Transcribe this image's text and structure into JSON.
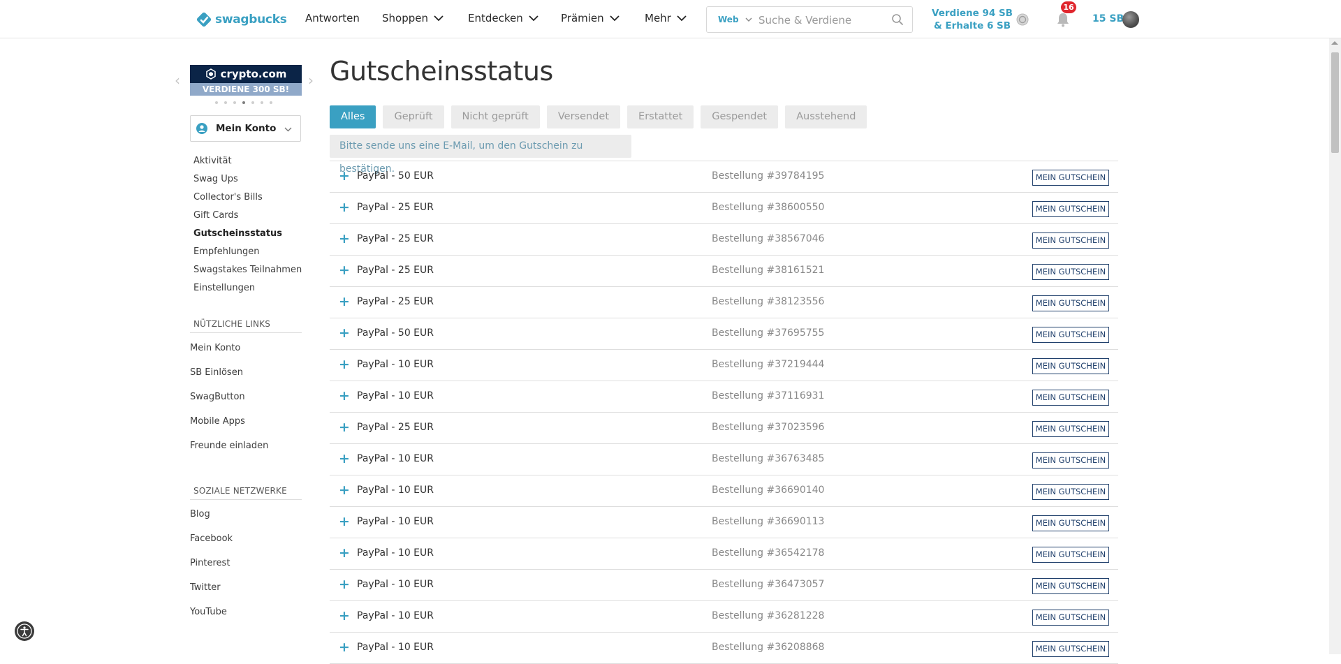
{
  "header": {
    "logo_text": "swagbucks",
    "nav": [
      {
        "label": "Antworten"
      },
      {
        "label": "Shoppen"
      },
      {
        "label": "Entdecken"
      },
      {
        "label": "Prämien"
      },
      {
        "label": "Mehr"
      }
    ],
    "search": {
      "scope": "Web",
      "placeholder": "Suche & Verdiene"
    },
    "earn_line1": "Verdiene 94 SB",
    "earn_line2": "& Erhalte 6 SB",
    "notification_count": "16",
    "sb_balance": "15 SB"
  },
  "sidebar": {
    "promo_brand": "crypto.com",
    "promo_cta": "VERDIENE 300 SB!",
    "account_label": "Mein Konto",
    "links": [
      {
        "label": "Aktivität"
      },
      {
        "label": "Swag Ups"
      },
      {
        "label": "Collector's Bills"
      },
      {
        "label": "Gift Cards"
      },
      {
        "label": "Gutscheinsstatus"
      },
      {
        "label": "Empfehlungen"
      },
      {
        "label": "Swagstakes Teilnahmen"
      },
      {
        "label": "Einstellungen"
      }
    ],
    "useful_title": "NÜTZLICHE LINKS",
    "useful_links": [
      {
        "label": "Mein Konto"
      },
      {
        "label": "SB Einlösen"
      },
      {
        "label": "SwagButton"
      },
      {
        "label": "Mobile Apps"
      },
      {
        "label": "Freunde einladen"
      }
    ],
    "social_title": "SOZIALE NETZWERKE",
    "social_links": [
      {
        "label": "Blog"
      },
      {
        "label": "Facebook"
      },
      {
        "label": "Pinterest"
      },
      {
        "label": "Twitter"
      },
      {
        "label": "YouTube"
      }
    ]
  },
  "main": {
    "title": "Gutscheinsstatus",
    "tabs": [
      {
        "label": "Alles"
      },
      {
        "label": "Geprüft"
      },
      {
        "label": "Nicht geprüft"
      },
      {
        "label": "Versendet"
      },
      {
        "label": "Erstattet"
      },
      {
        "label": "Gespendet"
      },
      {
        "label": "Ausstehend"
      }
    ],
    "notice": "Bitte sende uns eine E-Mail, um den Gutschein zu bestätigen.",
    "button_label": "MEIN GUTSCHEIN",
    "orders": [
      {
        "name": "PayPal - 50 EUR",
        "order": "Bestellung #39784195"
      },
      {
        "name": "PayPal - 25 EUR",
        "order": "Bestellung #38600550"
      },
      {
        "name": "PayPal - 25 EUR",
        "order": "Bestellung #38567046"
      },
      {
        "name": "PayPal - 25 EUR",
        "order": "Bestellung #38161521"
      },
      {
        "name": "PayPal - 25 EUR",
        "order": "Bestellung #38123556"
      },
      {
        "name": "PayPal - 50 EUR",
        "order": "Bestellung #37695755"
      },
      {
        "name": "PayPal - 10 EUR",
        "order": "Bestellung #37219444"
      },
      {
        "name": "PayPal - 10 EUR",
        "order": "Bestellung #37116931"
      },
      {
        "name": "PayPal - 25 EUR",
        "order": "Bestellung #37023596"
      },
      {
        "name": "PayPal - 10 EUR",
        "order": "Bestellung #36763485"
      },
      {
        "name": "PayPal - 10 EUR",
        "order": "Bestellung #36690140"
      },
      {
        "name": "PayPal - 10 EUR",
        "order": "Bestellung #36690113"
      },
      {
        "name": "PayPal - 10 EUR",
        "order": "Bestellung #36542178"
      },
      {
        "name": "PayPal - 10 EUR",
        "order": "Bestellung #36473057"
      },
      {
        "name": "PayPal - 10 EUR",
        "order": "Bestellung #36281228"
      },
      {
        "name": "PayPal - 10 EUR",
        "order": "Bestellung #36208868"
      }
    ]
  },
  "colors": {
    "accent": "#3aa0c2",
    "badge": "#e0262d",
    "promo_dark": "#0b2447",
    "button_border": "#1f3f6b"
  },
  "icons": {
    "logo": "swagbucks-logo-icon",
    "chevron": "chevron-down-icon",
    "search": "search-icon",
    "coin": "swagbucks-coin-icon",
    "bell": "bell-icon",
    "avatar": "avatar",
    "user": "user-icon",
    "plus": "plus-icon",
    "accessibility": "accessibility-icon"
  }
}
